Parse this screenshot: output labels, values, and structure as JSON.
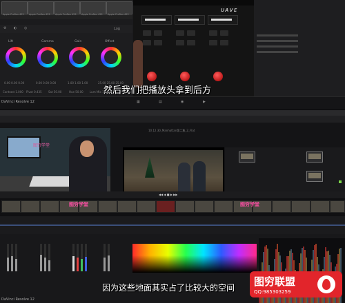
{
  "top": {
    "app_title": "DaVinci Resolve 12",
    "brand_logo": "ᴜᴀᴠᴇ",
    "subtitle": "然后我们把播放头拿到后方",
    "panel_toolbar": {
      "zoom": "Log"
    },
    "wheels": [
      {
        "label": "Lift",
        "values": "0.00 0.00 0.00"
      },
      {
        "label": "Gamma",
        "values": "0.00 0.00 0.00"
      },
      {
        "label": "Gain",
        "values": "1.00 1.00 1.00"
      },
      {
        "label": "Offset",
        "values": "25.00 25.00 25.00"
      }
    ],
    "footer_values": [
      "Contrast 1.000",
      "Pivot 0.435",
      "Sat 50.00",
      "Hue 50.00",
      "Lum Mix 100.00"
    ],
    "thumb_caption": "Apple ProRes 422"
  },
  "bottom": {
    "app_title": "DaVinci Resolve 12",
    "viewer_title": "10.12.30_Manhattan第二集_2_Flat",
    "timecode": "01:00:43:21",
    "watermark": "图穷学堂",
    "subtitle": "因为这些地面其实占了比较大的空间"
  },
  "logo": {
    "name": "图穷联盟",
    "qq": "QQ:985303259"
  },
  "icons": [
    "play-icon",
    "stop-icon",
    "loop-icon",
    "settings-icon",
    "flame-icon"
  ],
  "colors": {
    "accent_red": "#e2252b",
    "watermark_pink": "#ff4fa6"
  }
}
